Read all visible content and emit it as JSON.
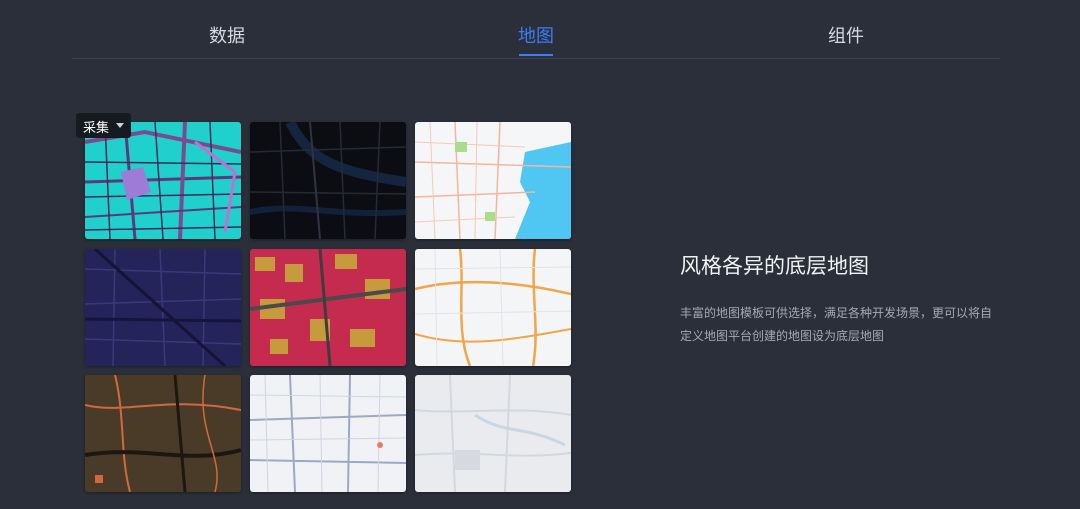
{
  "tabs": [
    {
      "label": "数据",
      "active": false
    },
    {
      "label": "地图",
      "active": true
    },
    {
      "label": "组件",
      "active": false
    }
  ],
  "accent_color": "#3d7cf6",
  "map_selector": {
    "selected": "采集"
  },
  "map_styles": [
    {
      "theme": "cyan-purple"
    },
    {
      "theme": "black"
    },
    {
      "theme": "light-blue-water"
    },
    {
      "theme": "indigo-night"
    },
    {
      "theme": "crimson-gold"
    },
    {
      "theme": "light-orange-roads"
    },
    {
      "theme": "brown-copper"
    },
    {
      "theme": "light-gray-blue"
    },
    {
      "theme": "pale-gray"
    }
  ],
  "feature": {
    "title": "风格各异的底层地图",
    "description": "丰富的地图模板可供选择，满足各种开发场景，更可以将自定义地图平台创建的地图设为底层地图"
  }
}
